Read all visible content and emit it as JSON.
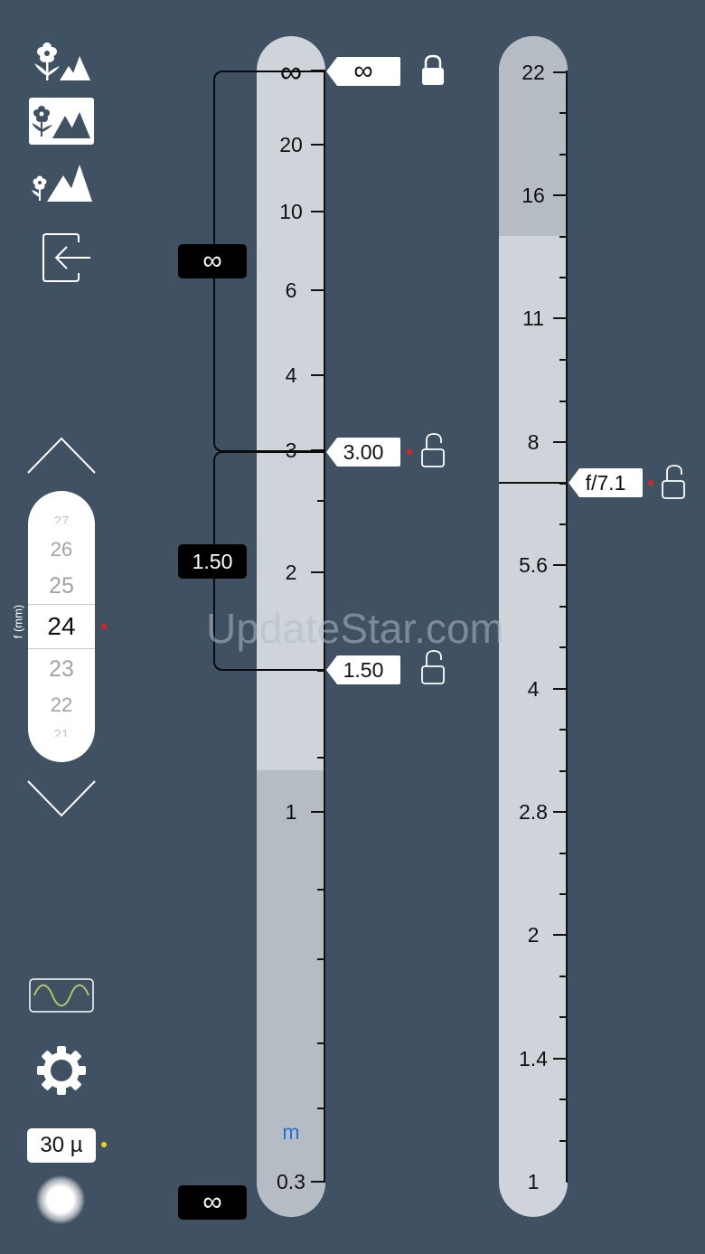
{
  "sidebar": {
    "modes": [
      {
        "name": "macro-mode",
        "icon": "flower-mountain-icon",
        "selected": false
      },
      {
        "name": "normal-mode",
        "icon": "flower-mountain-icon",
        "selected": true
      },
      {
        "name": "landscape-mode",
        "icon": "flower-mountain-icon",
        "selected": false
      }
    ],
    "exit_icon": "exit-arrow-icon",
    "focal_wheel": {
      "axis_label": "f (mm)",
      "items_above": [
        "27",
        "26",
        "25"
      ],
      "selected": "24",
      "items_below": [
        "23",
        "22",
        "21"
      ]
    },
    "up_icon": "chevron-up-icon",
    "down_icon": "chevron-down-icon",
    "wave_icon": "sine-wave-icon",
    "settings_icon": "gear-icon",
    "coc_value": "30 µ",
    "light_icon": "glow-icon"
  },
  "distance_scale": {
    "top_label": "∞",
    "tick_labels": [
      "20",
      "10",
      "6",
      "4",
      "3",
      "2",
      "1",
      "0.3"
    ],
    "unit": "m",
    "far_limit_tag": "∞",
    "focus_tag": "3.00",
    "near_limit_tag": "1.50",
    "far_depth_label": "∞",
    "near_depth_label": "1.50",
    "hyperfocal_label": "∞"
  },
  "aperture_scale": {
    "tick_labels": [
      "22",
      "16",
      "11",
      "8",
      "5.6",
      "4",
      "2.8",
      "2",
      "1.4",
      "1"
    ],
    "aperture_tag": "f/7.1"
  },
  "watermark": "UpdateStar.com",
  "colors": {
    "background": "#3f5162",
    "track_light": "#ced4da",
    "track_dark": "#b5bcc4",
    "accent_red": "#e0202a",
    "accent_yellow": "#f2d21b",
    "unit_blue": "#2a6fd6"
  }
}
